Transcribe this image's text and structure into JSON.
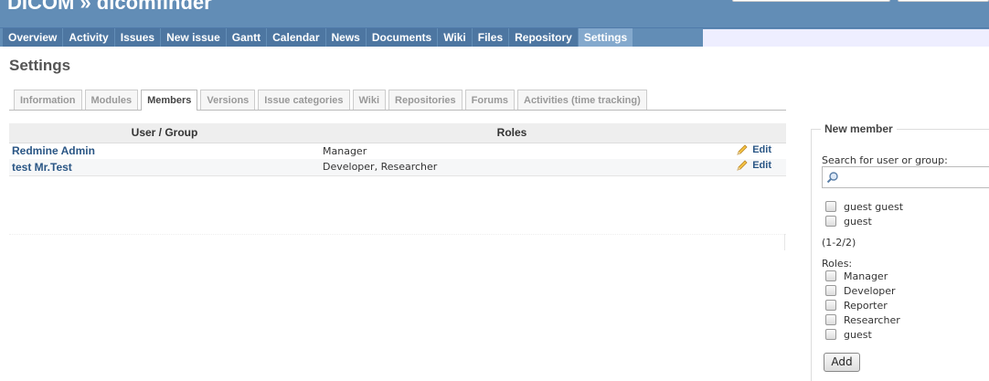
{
  "header": {
    "project_title": "DICOM » dicomfinder"
  },
  "main_menu": {
    "items": [
      "Overview",
      "Activity",
      "Issues",
      "New issue",
      "Gantt",
      "Calendar",
      "News",
      "Documents",
      "Wiki",
      "Files",
      "Repository",
      "Settings"
    ],
    "selected": "Settings"
  },
  "page": {
    "title": "Settings"
  },
  "tabs": {
    "items": [
      "Information",
      "Modules",
      "Members",
      "Versions",
      "Issue categories",
      "Wiki",
      "Repositories",
      "Forums",
      "Activities (time tracking)"
    ],
    "selected": "Members"
  },
  "members_table": {
    "headers": [
      "User / Group",
      "Roles"
    ],
    "rows": [
      {
        "user": "Redmine Admin",
        "roles": "Manager",
        "action": "Edit"
      },
      {
        "user": "test Mr.Test",
        "roles": "Developer, Researcher",
        "action": "Edit"
      }
    ]
  },
  "new_member": {
    "legend": "New member",
    "search_label": "Search for user or group:",
    "search_value": "",
    "principals": [
      "guest guest",
      "guest"
    ],
    "pagination": "(1-2/2)",
    "roles_label": "Roles:",
    "roles": [
      "Manager",
      "Developer",
      "Reporter",
      "Researcher",
      "guest"
    ],
    "add_label": "Add"
  },
  "colors": {
    "header_bg": "#628db6",
    "menu_item_bg": "#4d76a1",
    "menu_selected_bg": "#84a9cd",
    "link": "#2a5685"
  },
  "icons": {
    "edit": "pencil-icon",
    "search": "magnifier-icon"
  }
}
